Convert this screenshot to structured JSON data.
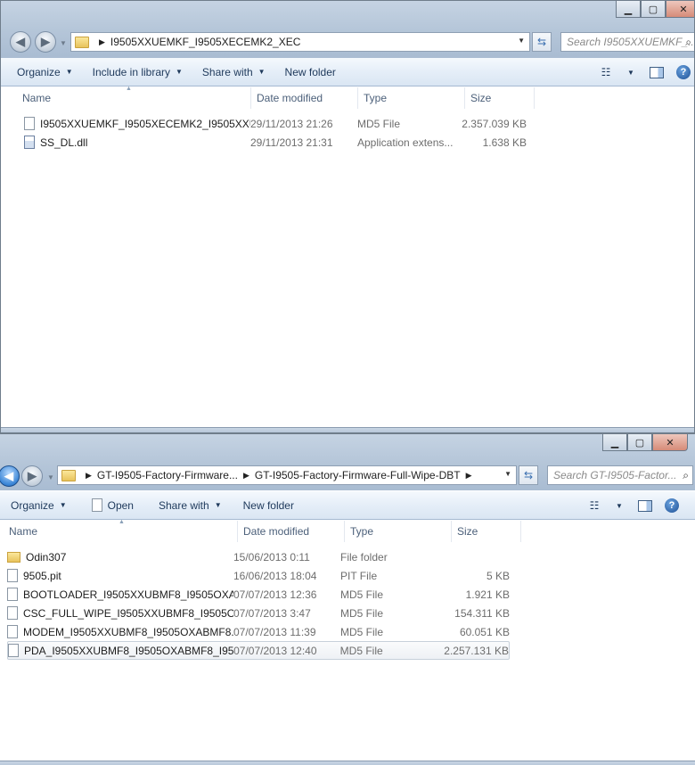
{
  "window1": {
    "caption_buttons": {
      "minimize": "▁",
      "maximize": "▢",
      "close": "✕"
    },
    "address": {
      "segments": [
        "I9505XXUEMKF_I9505XECEMK2_XEC"
      ]
    },
    "search_placeholder": "Search I9505XXUEMKF_...",
    "toolbar": {
      "organize": "Organize",
      "include_in_library": "Include in library",
      "share_with": "Share with",
      "new_folder": "New folder"
    },
    "columns": {
      "name": "Name",
      "date": "Date modified",
      "type": "Type",
      "size": "Size"
    },
    "files": [
      {
        "name": "I9505XXUEMKF_I9505XECEMK2_I9505XXU...",
        "date": "29/11/2013 21:26",
        "type": "MD5 File",
        "size": "2.357.039 KB",
        "icon": "file-icon"
      },
      {
        "name": "SS_DL.dll",
        "date": "29/11/2013 21:31",
        "type": "Application extens...",
        "size": "1.638 KB",
        "icon": "dll-icon"
      }
    ]
  },
  "window2": {
    "caption_buttons": {
      "minimize": "▁",
      "maximize": "▢",
      "close": "✕"
    },
    "address": {
      "segments": [
        "GT-I9505-Factory-Firmware...",
        "GT-I9505-Factory-Firmware-Full-Wipe-DBT"
      ]
    },
    "search_placeholder": "Search GT-I9505-Factor...",
    "toolbar": {
      "organize": "Organize",
      "open": "Open",
      "share_with": "Share with",
      "new_folder": "New folder"
    },
    "columns": {
      "name": "Name",
      "date": "Date modified",
      "type": "Type",
      "size": "Size"
    },
    "files": [
      {
        "name": "Odin307",
        "date": "15/06/2013 0:11",
        "type": "File folder",
        "size": "",
        "icon": "folder-icon"
      },
      {
        "name": "9505.pit",
        "date": "16/06/2013 18:04",
        "type": "PIT File",
        "size": "5 KB",
        "icon": "file-icon"
      },
      {
        "name": "BOOTLOADER_I9505XXUBMF8_I9505OXA...",
        "date": "07/07/2013 12:36",
        "type": "MD5 File",
        "size": "1.921 KB",
        "icon": "file-icon"
      },
      {
        "name": "CSC_FULL_WIPE_I9505XXUBMF8_I9505OX...",
        "date": "07/07/2013 3:47",
        "type": "MD5 File",
        "size": "154.311 KB",
        "icon": "file-icon"
      },
      {
        "name": "MODEM_I9505XXUBMF8_I9505OXABMF8...",
        "date": "07/07/2013 11:39",
        "type": "MD5 File",
        "size": "60.051 KB",
        "icon": "file-icon"
      },
      {
        "name": "PDA_I9505XXUBMF8_I9505OXABMF8_I95...",
        "date": "07/07/2013 12:40",
        "type": "MD5 File",
        "size": "2.257.131 KB",
        "icon": "file-icon",
        "selected": true
      }
    ]
  }
}
